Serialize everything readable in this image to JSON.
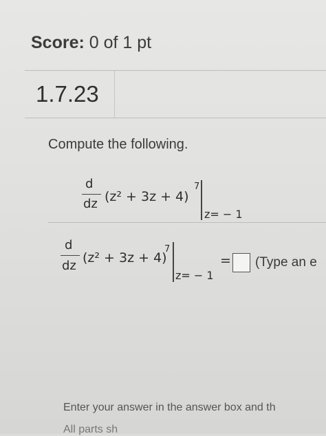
{
  "score": {
    "label": "Score:",
    "value": "0 of 1 pt"
  },
  "question": {
    "number": "1.7.23",
    "prompt": "Compute the following."
  },
  "problem": {
    "derivative_numerator": "d",
    "derivative_denominator": "dz",
    "expression": "(z² + 3z + 4)",
    "exponent": "7",
    "evaluated_at": "z= − 1"
  },
  "answer_line": {
    "derivative_numerator": "d",
    "derivative_denominator": "dz",
    "expression": "(z² + 3z + 4)",
    "exponent": "7",
    "evaluated_at": "z= − 1",
    "equals": "=",
    "hint": "(Type an e"
  },
  "footer": {
    "instruction": "Enter your answer in the answer box and th",
    "cutoff": "All parts sh"
  }
}
